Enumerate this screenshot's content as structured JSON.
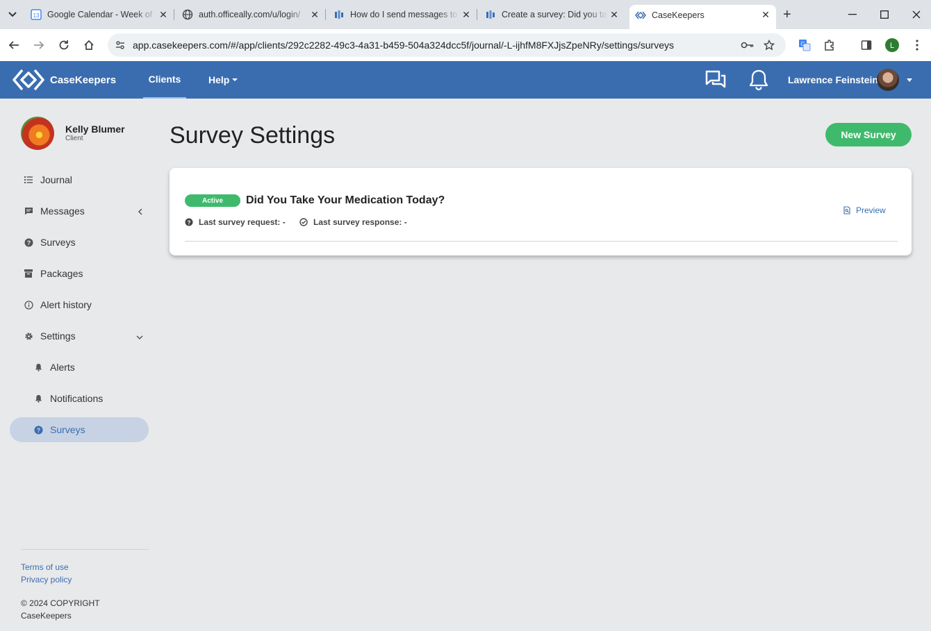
{
  "browser": {
    "tabs": [
      {
        "title": "Google Calendar - Week of",
        "favicon": "calendar-icon",
        "favicon_text": "13"
      },
      {
        "title": "auth.officeally.com/u/login/",
        "favicon": "globe-icon"
      },
      {
        "title": "How do I send messages to",
        "favicon": "helpdesk-icon"
      },
      {
        "title": "Create a survey: Did you take",
        "favicon": "helpdesk-icon"
      },
      {
        "title": "CaseKeepers",
        "favicon": "casekeepers-icon",
        "active": true
      }
    ],
    "url": "app.casekeepers.com/#/app/clients/292c2282-49c3-4a31-b459-504a324dcc5f/journal/-L-ijhfM8FXJjsZpeNRy/settings/surveys",
    "profile_initial": "L"
  },
  "header": {
    "brand": "CaseKeepers",
    "nav": [
      {
        "label": "Clients",
        "active": true
      },
      {
        "label": "Help"
      }
    ],
    "user_name": "Lawrence Feinstein"
  },
  "sidebar": {
    "client_name": "Kelly Blumer",
    "client_role": "Client",
    "items": [
      {
        "label": "Journal",
        "icon": "list-icon"
      },
      {
        "label": "Messages",
        "icon": "message-icon",
        "chevron": "left"
      },
      {
        "label": "Surveys",
        "icon": "question-circle-icon"
      },
      {
        "label": "Packages",
        "icon": "archive-icon"
      },
      {
        "label": "Alert history",
        "icon": "info-circle-icon"
      },
      {
        "label": "Settings",
        "icon": "gear-icon",
        "chevron": "down"
      },
      {
        "label": "Alerts",
        "icon": "bell-icon",
        "sub": true
      },
      {
        "label": "Notifications",
        "icon": "bell-icon",
        "sub": true
      },
      {
        "label": "Surveys",
        "icon": "question-circle-icon",
        "sub": true,
        "active": true
      }
    ],
    "footer": {
      "terms": "Terms of use",
      "privacy": "Privacy policy",
      "copyright_line1": "© 2024 COPYRIGHT",
      "copyright_line2": "CaseKeepers"
    }
  },
  "main": {
    "title": "Survey Settings",
    "new_survey_label": "New Survey",
    "survey": {
      "status": "Active",
      "title": "Did You Take Your Medication Today?",
      "last_request": "Last survey request: -",
      "last_response": "Last survey response: -",
      "preview_label": "Preview"
    }
  },
  "colors": {
    "primary": "#3a6db0",
    "success": "#3fba6c",
    "background": "#e8e9eb"
  }
}
